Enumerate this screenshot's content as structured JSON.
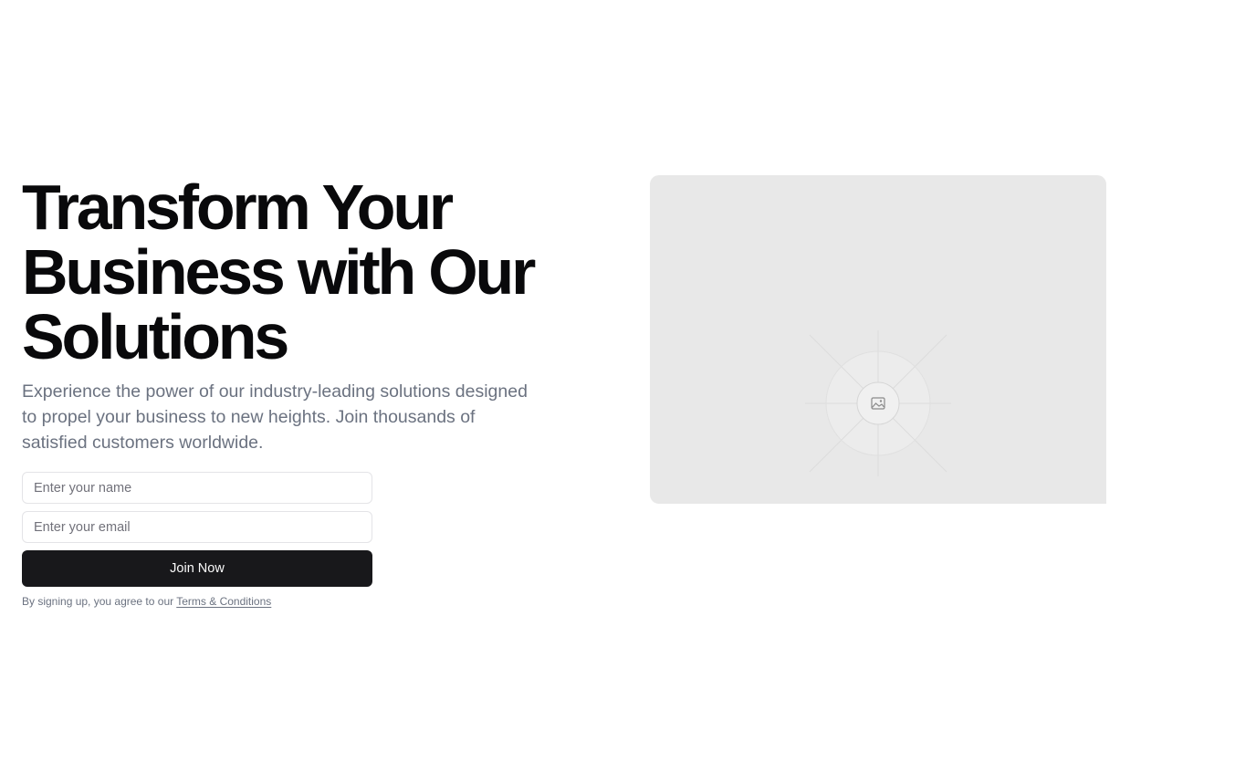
{
  "hero": {
    "headline_line1": "Transform Your",
    "headline_line2": "Business with Our",
    "headline_line3": "Solutions",
    "subtext": "Experience the power of our industry-leading solutions designed to propel your business to new heights. Join thousands of satisfied customers worldwide."
  },
  "form": {
    "name_placeholder": "Enter your name",
    "email_placeholder": "Enter your email",
    "submit_label": "Join Now",
    "legal_prefix": "By signing up, you agree to our ",
    "terms_link": "Terms & Conditions"
  },
  "media": {
    "icon": "image-placeholder-icon"
  },
  "colors": {
    "heading": "#09090b",
    "muted_text": "#6b7280",
    "button_bg": "#18181b",
    "button_text": "#fafafa",
    "placeholder_bg": "#e8e8e8"
  }
}
